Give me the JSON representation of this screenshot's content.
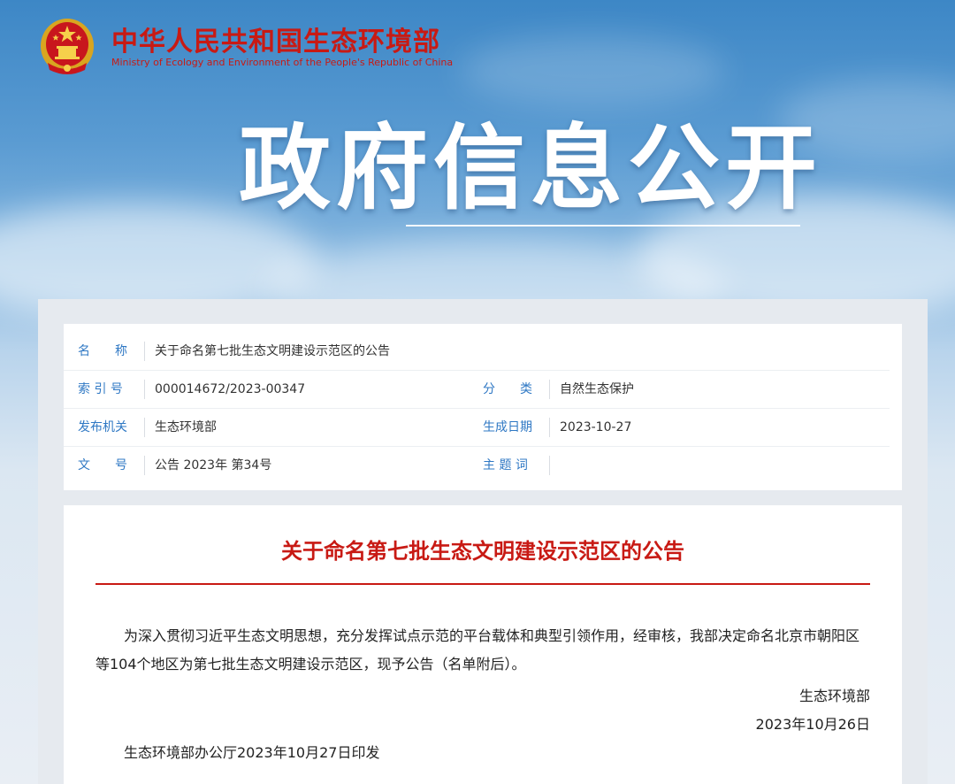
{
  "header": {
    "org_cn": "中华人民共和国生态环境部",
    "org_en": "Ministry of Ecology and Environment of the People's Republic of China",
    "hero_title": "政府信息公开",
    "emblem_icon": "national-emblem-icon"
  },
  "meta": {
    "name_label": "名　　称",
    "name_value": "关于命名第七批生态文明建设示范区的公告",
    "index_label": "索 引 号",
    "index_value": "000014672/2023-00347",
    "category_label": "分　　类",
    "category_value": "自然生态保护",
    "issuer_label": "发布机关",
    "issuer_value": "生态环境部",
    "date_label": "生成日期",
    "date_value": "2023-10-27",
    "docnum_label": "文　　号",
    "docnum_value": "公告 2023年 第34号",
    "subject_label": "主 题 词",
    "subject_value": ""
  },
  "document": {
    "title": "关于命名第七批生态文明建设示范区的公告",
    "paragraph": "为深入贯彻习近平生态文明思想，充分发挥试点示范的平台载体和典型引领作用，经审核，我部决定命名北京市朝阳区等104个地区为第七批生态文明建设示范区，现予公告（名单附后）。",
    "signatory": "生态环境部",
    "sign_date": "2023年10月26日",
    "print_note": "生态环境部办公厅2023年10月27日印发"
  },
  "colors": {
    "brand_red": "#c81a14",
    "label_blue": "#2f78c4",
    "sky_blue": "#3d87c6"
  }
}
